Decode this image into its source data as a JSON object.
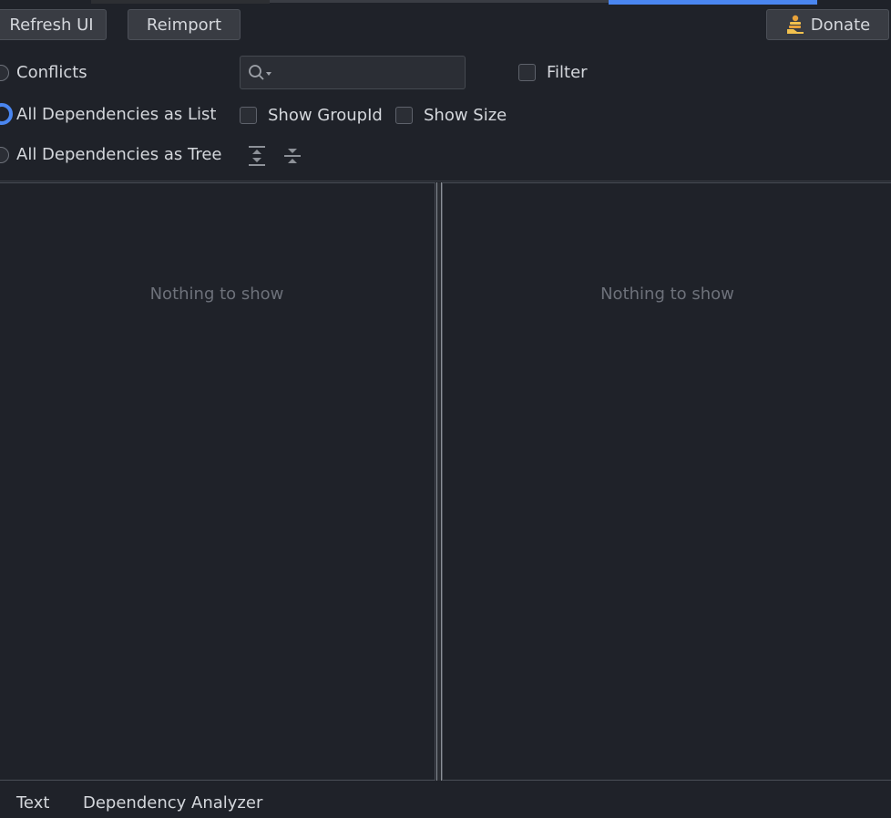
{
  "toolbar": {
    "refresh_label": "Refresh UI",
    "reimport_label": "Reimport",
    "donate_label": "Donate"
  },
  "view_modes": {
    "conflicts": "Conflicts",
    "list": "All Dependencies as List",
    "tree": "All Dependencies as Tree",
    "selected": "list"
  },
  "search": {
    "value": ""
  },
  "options": {
    "filter": "Filter",
    "show_group_id": "Show GroupId",
    "show_size": "Show Size"
  },
  "panels": {
    "left_empty": "Nothing to show",
    "right_empty": "Nothing to show"
  },
  "bottom_tabs": [
    "Text",
    "Dependency Analyzer"
  ],
  "colors": {
    "accent": "#4a86f0",
    "background": "#1f2229"
  }
}
